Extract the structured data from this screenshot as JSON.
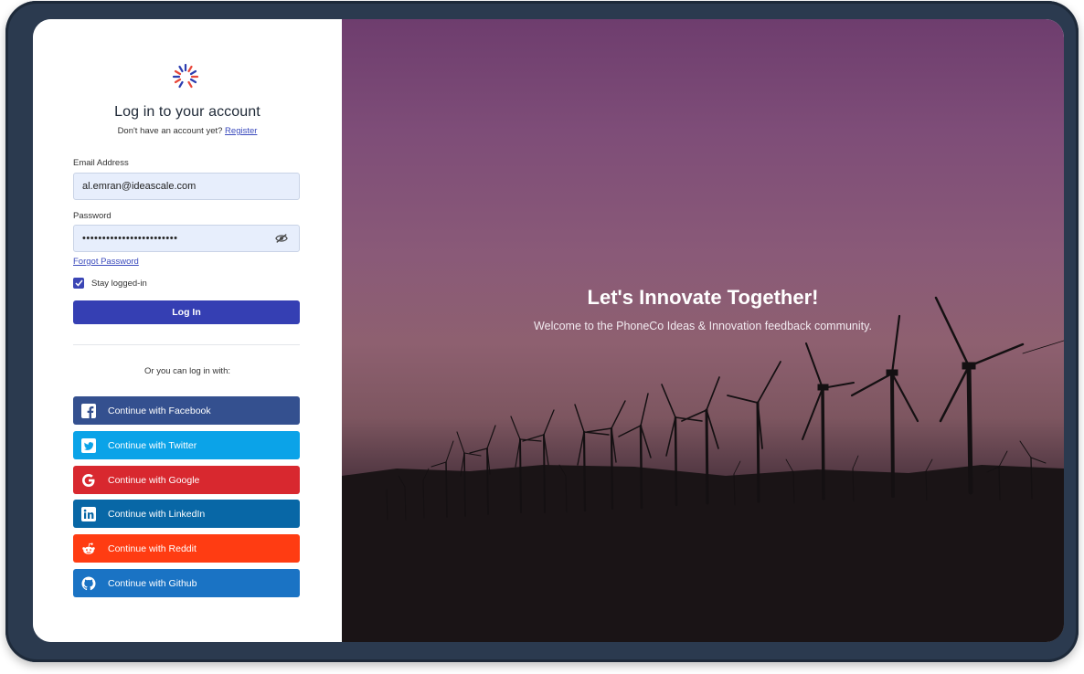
{
  "login": {
    "title": "Log in to your account",
    "no_account_text": "Don't have an account yet?",
    "register_link": "Register",
    "email_label": "Email Address",
    "email_value": "al.emran@ideascale.com",
    "password_label": "Password",
    "password_masked": "••••••••••••••••••••••••",
    "forgot_password": "Forgot Password",
    "stay_logged_in": "Stay logged-in",
    "stay_logged_in_checked": true,
    "login_button": "Log In",
    "or_text": "Or you can log in with:"
  },
  "social": [
    {
      "label": "Continue with Facebook",
      "color": "#34508f",
      "icon": "facebook-icon"
    },
    {
      "label": "Continue with Twitter",
      "color": "#0ba3e8",
      "icon": "twitter-icon"
    },
    {
      "label": "Continue with Google",
      "color": "#d8282f",
      "icon": "google-icon"
    },
    {
      "label": "Continue with LinkedIn",
      "color": "#0867a6",
      "icon": "linkedin-icon"
    },
    {
      "label": "Continue with Reddit",
      "color": "#ff3c12",
      "icon": "reddit-icon"
    },
    {
      "label": "Continue with Github",
      "color": "#1a73c4",
      "icon": "github-icon"
    }
  ],
  "hero": {
    "title": "Let's Innovate Together!",
    "subtitle": "Welcome to the PhoneCo Ideas & Innovation feedback community."
  },
  "colors": {
    "primary": "#353fb3",
    "link": "#3b4bbd",
    "input_bg": "#e7eefc"
  }
}
